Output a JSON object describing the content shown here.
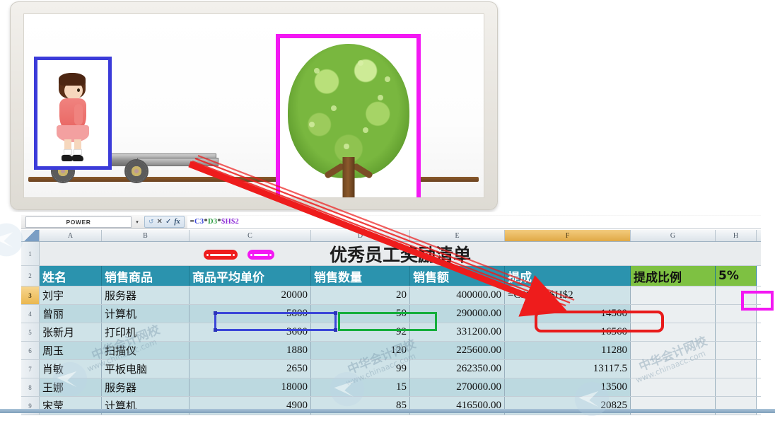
{
  "illustration": {
    "name": "cart-and-tree-analogy",
    "girl_box_color": "#3b3bd9",
    "tree_box_color": "#f318f3",
    "alt_girl": "girl-on-cart",
    "alt_tree": "tree-fixed-on-ground"
  },
  "formula_bar": {
    "name_box": "POWER",
    "cancel_icon": "✕",
    "confirm_icon": "✓",
    "function_icon": "fx",
    "dropdown_icon": "▾",
    "undo_icon": "↺",
    "formula_parts": [
      {
        "text": "=",
        "color": "#222222"
      },
      {
        "text": "C3",
        "color": "#3b46d8"
      },
      {
        "text": "*",
        "color": "#222222"
      },
      {
        "text": "D3",
        "color": "#2f9e43"
      },
      {
        "text": "*",
        "color": "#222222"
      },
      {
        "text": "$H$2",
        "color": "#8f2fd8"
      }
    ],
    "formula_text": "=C3*D3*$H$2"
  },
  "sheet": {
    "columns": [
      "A",
      "B",
      "C",
      "D",
      "E",
      "F",
      "G",
      "H"
    ],
    "active_column": "F",
    "active_row": "3",
    "row_numbers": [
      "1",
      "2",
      "3",
      "4",
      "5",
      "6",
      "7",
      "8",
      "9"
    ],
    "title": "优秀员工奖励清单",
    "header": {
      "a": "姓名",
      "b": "销售商品",
      "c": "商品平均单价",
      "d": "销售数量",
      "e": "销售额",
      "f": "提成",
      "g": "提成比例",
      "h": "5%"
    },
    "rows": [
      {
        "num": "3",
        "a": "刘宇",
        "b": "服务器",
        "c": "20000",
        "d": "20",
        "e": "400000.00",
        "f": "=C3*D3*$H$2"
      },
      {
        "num": "4",
        "a": "曾丽",
        "b": "计算机",
        "c": "5800",
        "d": "50",
        "e": "290000.00",
        "f": "14500"
      },
      {
        "num": "5",
        "a": "张新月",
        "b": "打印机",
        "c": "3600",
        "d": "92",
        "e": "331200.00",
        "f": "16560"
      },
      {
        "num": "6",
        "a": "周玉",
        "b": "扫描仪",
        "c": "1880",
        "d": "120",
        "e": "225600.00",
        "f": "11280"
      },
      {
        "num": "7",
        "a": "肖敏",
        "b": "平板电脑",
        "c": "2650",
        "d": "99",
        "e": "262350.00",
        "f": "13117.5"
      },
      {
        "num": "8",
        "a": "王娜",
        "b": "服务器",
        "c": "18000",
        "d": "15",
        "e": "270000.00",
        "f": "13500"
      },
      {
        "num": "9",
        "a": "宋莹",
        "b": "计算机",
        "c": "4900",
        "d": "85",
        "e": "416500.00",
        "f": "20825"
      }
    ]
  },
  "annotations": {
    "c3_selection_color": "#3b46d8",
    "d3_selection_color": "#14ae3b",
    "f3_highlight_color": "#e81b1b",
    "h2_highlight_color": "#f318f3",
    "arrow_color": "#ee1c1c"
  },
  "watermarks": {
    "brand_cn": "中华会计网校",
    "brand_url": "www.chinaacc.com"
  }
}
